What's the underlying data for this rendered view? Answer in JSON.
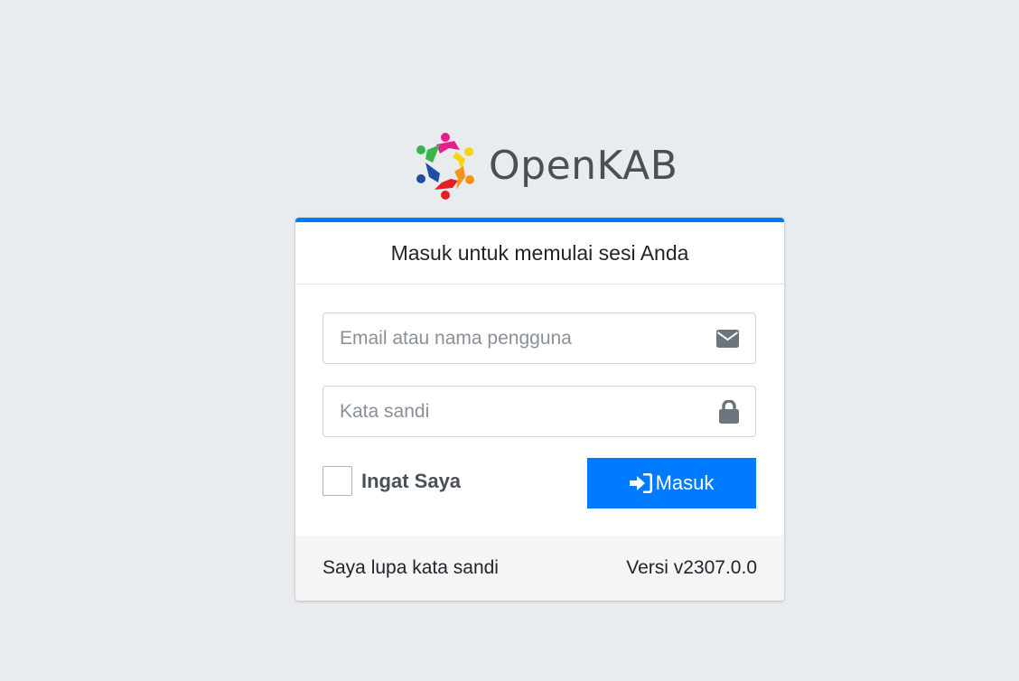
{
  "brand": {
    "name": "OpenKAB",
    "logo_colors": [
      "#e91e8c",
      "#f7d417",
      "#f6921e",
      "#e31e24",
      "#1f4fa3",
      "#39b54a"
    ]
  },
  "login_card": {
    "accent_color": "#007bff",
    "header": "Masuk untuk memulai sesi Anda",
    "email": {
      "placeholder": "Email atau nama pengguna",
      "value": "",
      "icon": "envelope-icon"
    },
    "password": {
      "placeholder": "Kata sandi",
      "value": "",
      "icon": "lock-icon"
    },
    "remember": {
      "label": "Ingat Saya",
      "checked": false
    },
    "submit": {
      "label": "Masuk",
      "icon": "sign-in-icon"
    },
    "footer": {
      "forgot_link": "Saya lupa kata sandi",
      "version": "Versi v2307.0.0"
    }
  }
}
